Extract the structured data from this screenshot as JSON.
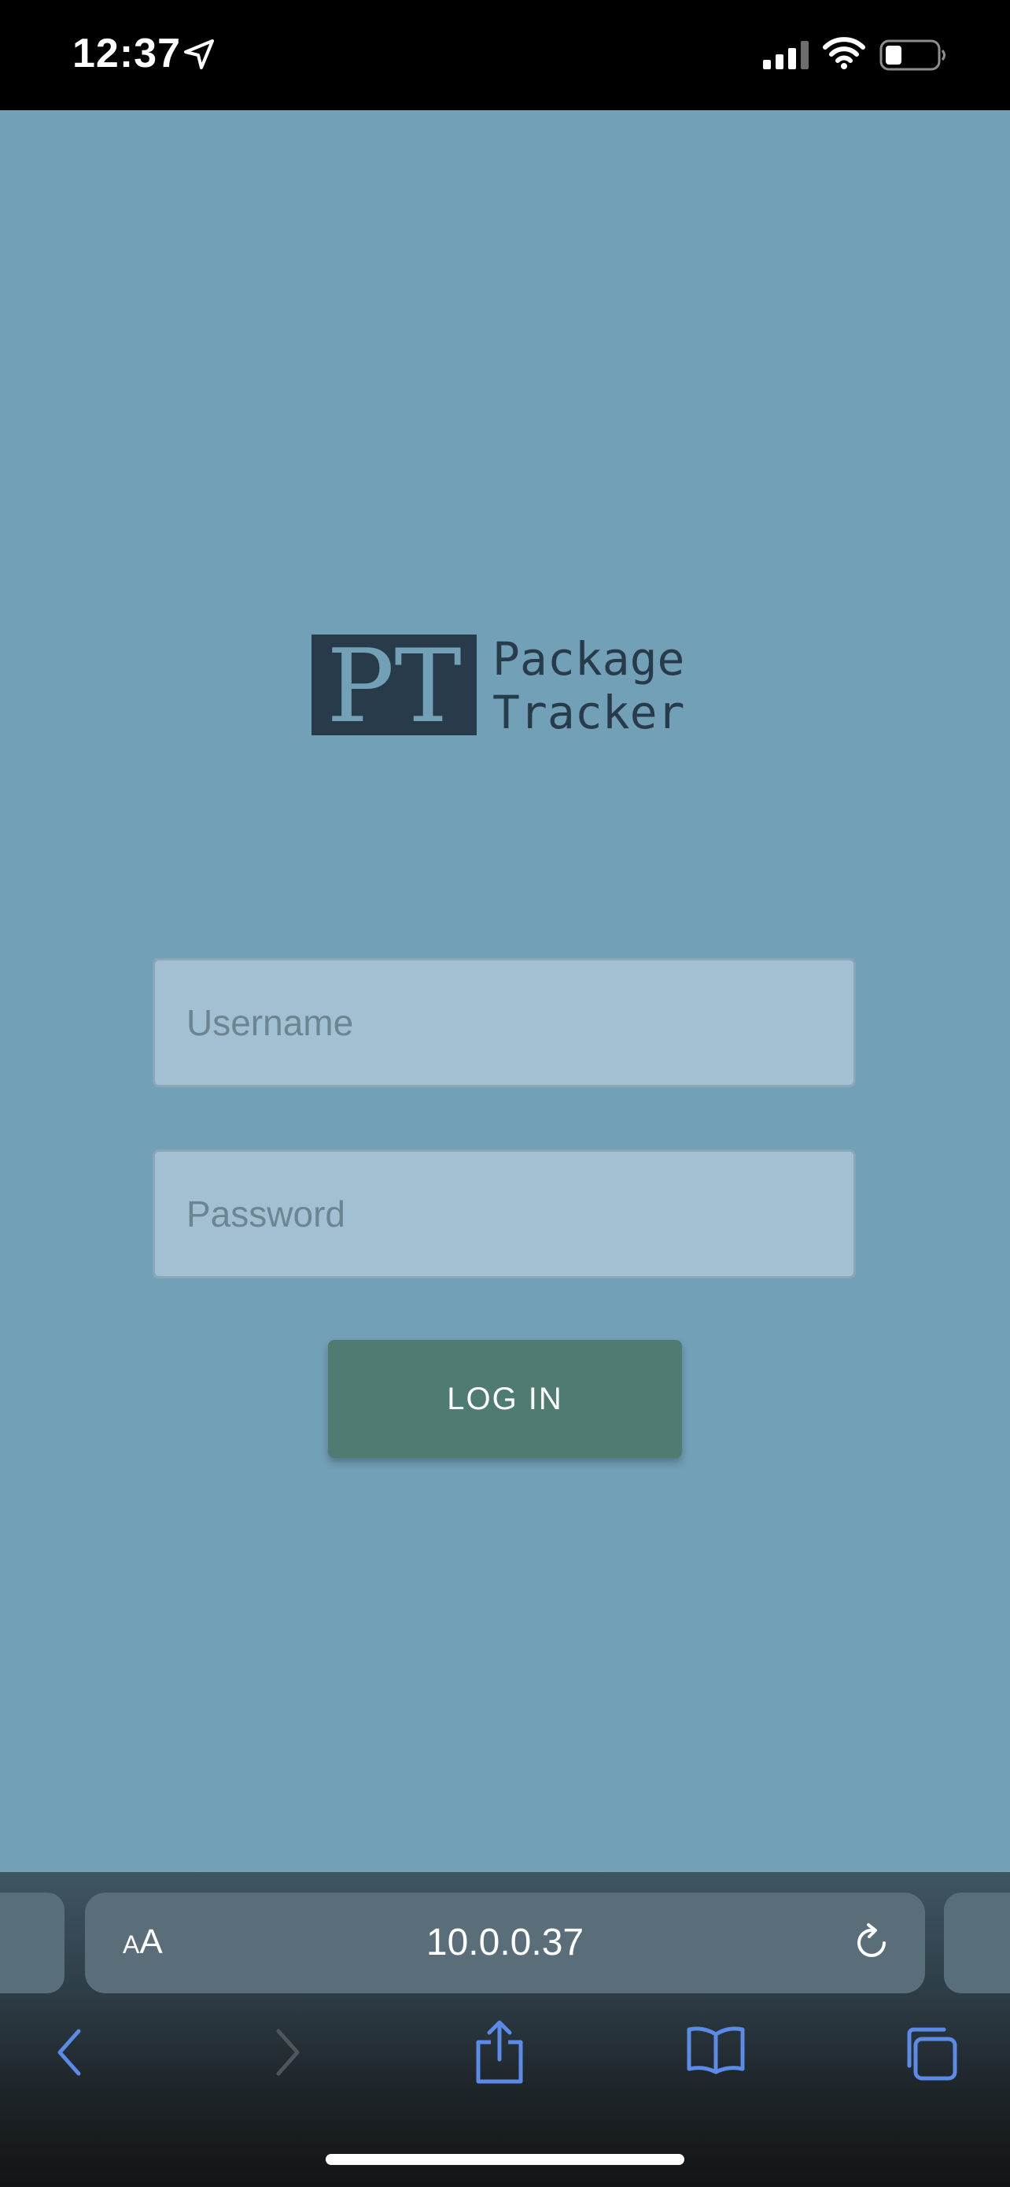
{
  "status_bar": {
    "time": "12:37",
    "icons": [
      "location-arrow-icon",
      "cellular-signal-icon",
      "wifi-icon",
      "battery-icon"
    ]
  },
  "logo": {
    "mark": "PT",
    "line1": "Package",
    "line2": "Tracker"
  },
  "form": {
    "username_placeholder": "Username",
    "password_placeholder": "Password",
    "login_label": "LOG IN"
  },
  "browser": {
    "text_size_label_small": "A",
    "text_size_label_large": "A",
    "url": "10.0.0.37",
    "toolbar_icons": [
      "back-icon",
      "forward-icon",
      "share-icon",
      "bookmarks-icon",
      "tabs-icon"
    ]
  },
  "colors": {
    "background": "#72a0b7",
    "logo": "#283b4a",
    "button": "#4f7b72",
    "field": "#a2c0d2",
    "browser_accent": "#5b8be6"
  }
}
